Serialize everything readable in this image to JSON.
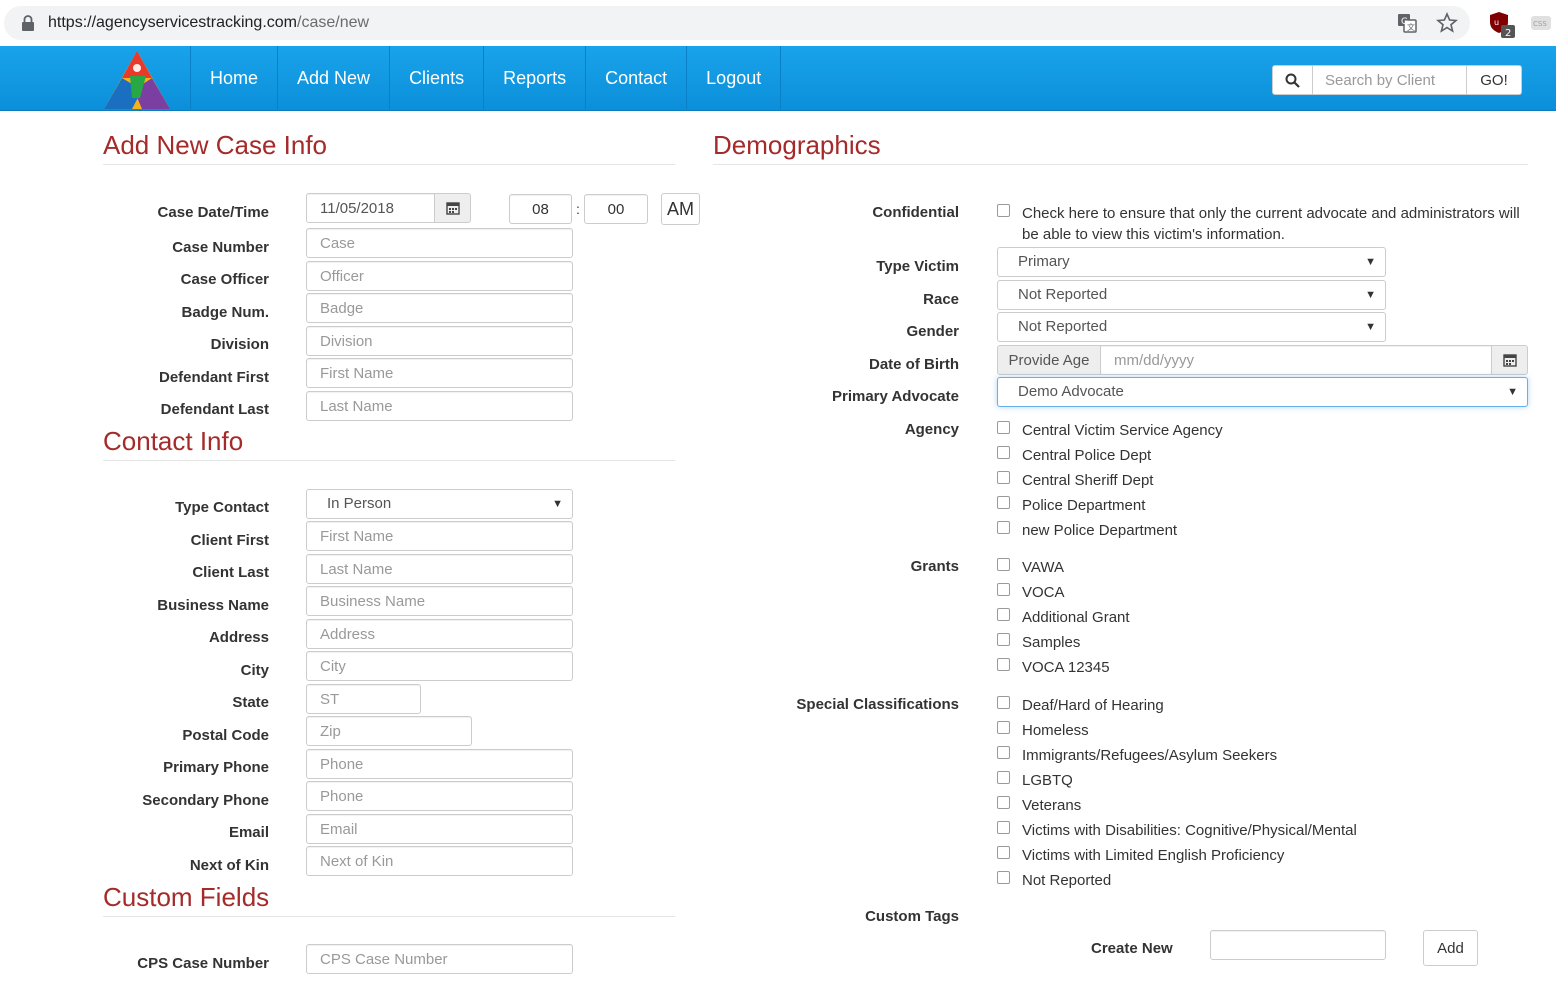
{
  "browser": {
    "url_host": "https://agencyservicestracking.com",
    "url_path": "/case/new",
    "ext_badge": "2"
  },
  "navbar": {
    "items": [
      "Home",
      "Add New",
      "Clients",
      "Reports",
      "Contact",
      "Logout"
    ],
    "search_placeholder": "Search by Client",
    "go_label": "GO!"
  },
  "case_info": {
    "title": "Add New Case Info",
    "date_label": "Case Date/Time",
    "date_value": "11/05/2018",
    "hour": "08",
    "minute": "00",
    "time_sep": ":",
    "ampm": "AM",
    "fields": [
      {
        "label": "Case Number",
        "placeholder": "Case"
      },
      {
        "label": "Case Officer",
        "placeholder": "Officer"
      },
      {
        "label": "Badge Num.",
        "placeholder": "Badge"
      },
      {
        "label": "Division",
        "placeholder": "Division"
      },
      {
        "label": "Defendant First",
        "placeholder": "First Name"
      },
      {
        "label": "Defendant Last",
        "placeholder": "Last Name"
      }
    ]
  },
  "contact_info": {
    "title": "Contact Info",
    "type_label": "Type Contact",
    "type_value": "In Person",
    "fields": [
      {
        "label": "Client First",
        "placeholder": "First Name"
      },
      {
        "label": "Client Last",
        "placeholder": "Last Name"
      },
      {
        "label": "Business Name",
        "placeholder": "Business Name"
      },
      {
        "label": "Address",
        "placeholder": "Address"
      },
      {
        "label": "City",
        "placeholder": "City"
      },
      {
        "label": "State",
        "placeholder": "ST"
      },
      {
        "label": "Postal Code",
        "placeholder": "Zip"
      },
      {
        "label": "Primary Phone",
        "placeholder": "Phone"
      },
      {
        "label": "Secondary Phone",
        "placeholder": "Phone"
      },
      {
        "label": "Email",
        "placeholder": "Email"
      },
      {
        "label": "Next of Kin",
        "placeholder": "Next of Kin"
      }
    ]
  },
  "custom_fields": {
    "title": "Custom Fields",
    "fields": [
      {
        "label": "CPS Case Number",
        "placeholder": "CPS Case Number"
      }
    ]
  },
  "demographics": {
    "title": "Demographics",
    "confidential_label": "Confidential",
    "confidential_text_1": "Check here to ensure that only the current advocate and administrators will",
    "confidential_text_2": "be able to view this victim's information.",
    "type_victim_label": "Type Victim",
    "type_victim_value": "Primary",
    "race_label": "Race",
    "race_value": "Not Reported",
    "gender_label": "Gender",
    "gender_value": "Not Reported",
    "dob_label": "Date of Birth",
    "dob_age_button": "Provide Age",
    "dob_placeholder": "mm/dd/yyyy",
    "advocate_label": "Primary Advocate",
    "advocate_value": "Demo Advocate",
    "agency_label": "Agency",
    "agencies": [
      "Central Victim Service Agency",
      "Central Police Dept",
      "Central Sheriff Dept",
      "Police Department",
      "new Police Department"
    ],
    "grants_label": "Grants",
    "grants": [
      "VAWA",
      "VOCA",
      "Additional Grant",
      "Samples",
      "VOCA 12345"
    ],
    "special_label": "Special Classifications",
    "special": [
      "Deaf/Hard of Hearing",
      "Homeless",
      "Immigrants/Refugees/Asylum Seekers",
      "LGBTQ",
      "Veterans",
      "Victims with Disabilities: Cognitive/Physical/Mental",
      "Victims with Limited English Proficiency",
      "Not Reported"
    ],
    "custom_tags_label": "Custom Tags",
    "create_new_label": "Create New",
    "add_label": "Add"
  }
}
